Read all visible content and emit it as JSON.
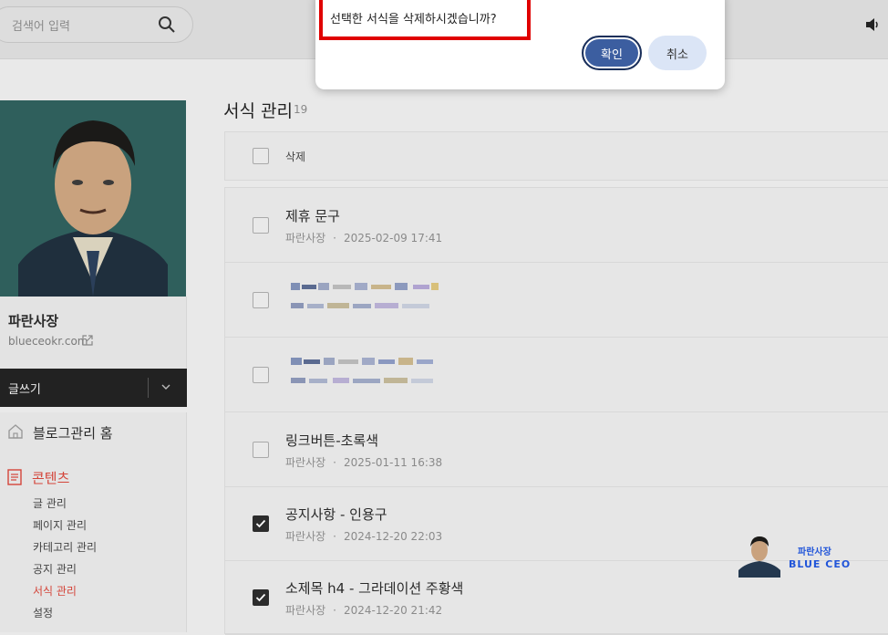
{
  "search": {
    "placeholder": "검색어 입력"
  },
  "dialog": {
    "message": "선택한 서식을 삭제하시겠습니까?",
    "ok_label": "확인",
    "cancel_label": "취소"
  },
  "profile": {
    "name": "파란사장",
    "url": "blueceokr.com"
  },
  "write": {
    "label": "글쓰기"
  },
  "nav": {
    "home": "블로그관리 홈",
    "content": "콘텐츠",
    "items": [
      "글 관리",
      "페이지 관리",
      "카테고리 관리",
      "공지 관리",
      "서식 관리",
      "설정"
    ]
  },
  "main": {
    "title": "서식 관리",
    "count": "19",
    "delete_label": "삭제",
    "rows": [
      {
        "title": "제휴 문구",
        "author": "파란사장",
        "date": "2025-02-09 17:41",
        "checked": false
      },
      {
        "title": "",
        "author": "",
        "date": "",
        "checked": false
      },
      {
        "title": "",
        "author": "",
        "date": "",
        "checked": false
      },
      {
        "title": "링크버튼-초록색",
        "author": "파란사장",
        "date": "2025-01-11 16:38",
        "checked": false
      },
      {
        "title": "공지사항 - 인용구",
        "author": "파란사장",
        "date": "2024-12-20 22:03",
        "checked": true
      },
      {
        "title": "소제목 h4 - 그라데이션 주황색",
        "author": "파란사장",
        "date": "2024-12-20 21:42",
        "checked": true
      }
    ]
  },
  "watermark": {
    "name": "파란사장",
    "brand": "BLUE CEO"
  },
  "colors": {
    "accent": "#d4453a",
    "ok_button": "#3c5ea0",
    "highlight_box": "#e00000",
    "watermark": "#2155d9"
  }
}
